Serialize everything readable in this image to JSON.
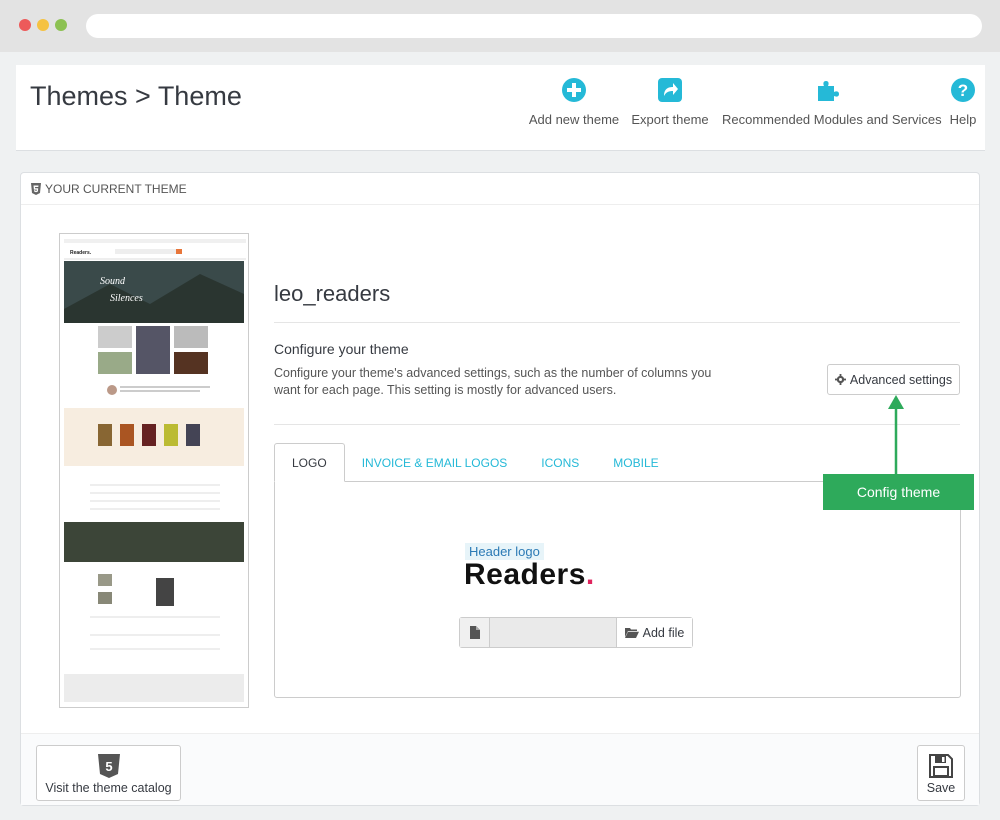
{
  "header": {
    "breadcrumb": "Themes > Theme",
    "toolbar": {
      "add_new_theme": "Add new theme",
      "export_theme": "Export theme",
      "recommended_modules": "Recommended Modules and Services",
      "help": "Help"
    }
  },
  "panel": {
    "title": "YOUR CURRENT THEME",
    "theme_name": "leo_readers",
    "configure_title": "Configure your theme",
    "configure_desc": "Configure your theme's advanced settings, such as the number of columns you want for each page. This setting is mostly for advanced users.",
    "advanced_settings_label": "Advanced settings",
    "tabs": [
      {
        "label": "LOGO"
      },
      {
        "label": "INVOICE & EMAIL LOGOS"
      },
      {
        "label": "ICONS"
      },
      {
        "label": "MOBILE"
      }
    ],
    "header_logo_label": "Header logo",
    "logo_text": "Readers",
    "logo_dot": ".",
    "add_file_label": "Add file",
    "catalog_label": "Visit the theme catalog",
    "save_label": "Save"
  },
  "annotation": {
    "callout": "Config theme"
  },
  "colors": {
    "accent": "#25b9d7",
    "callout_green": "#2eaa5b",
    "logo_dot": "#e0245e"
  }
}
